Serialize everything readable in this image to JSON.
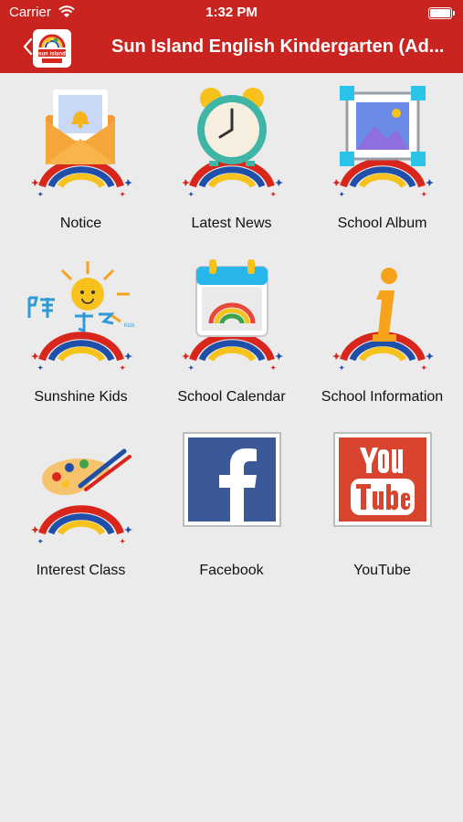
{
  "status": {
    "carrier": "Carrier",
    "time": "1:32 PM"
  },
  "header": {
    "title": "Sun Island English Kindergarten (Ad...",
    "logo_alt": "sun island"
  },
  "menu": [
    {
      "label": "Notice",
      "icon": "envelope-bell-icon"
    },
    {
      "label": "Latest News",
      "icon": "alarm-clock-icon"
    },
    {
      "label": "School Album",
      "icon": "photo-frame-icon"
    },
    {
      "label": "Sunshine Kids",
      "icon": "sunshine-kids-logo-icon"
    },
    {
      "label": "School Calendar",
      "icon": "calendar-rainbow-icon"
    },
    {
      "label": "School Information",
      "icon": "info-icon"
    },
    {
      "label": "Interest Class",
      "icon": "paint-palette-icon"
    },
    {
      "label": "Facebook",
      "icon": "facebook-icon"
    },
    {
      "label": "YouTube",
      "icon": "youtube-icon"
    }
  ],
  "colors": {
    "header": "#c9241f",
    "background": "#ebebeb",
    "facebook": "#3b5998",
    "youtube": "#d9442f"
  }
}
